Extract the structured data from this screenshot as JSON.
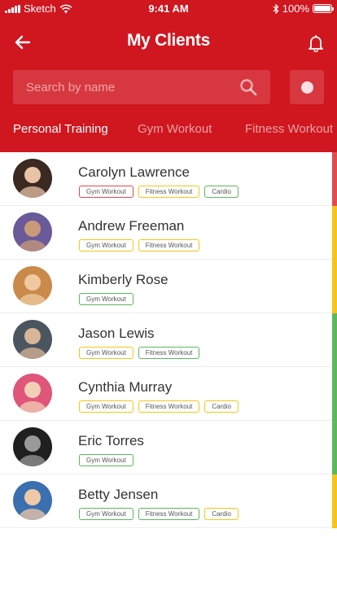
{
  "colors": {
    "primary": "#d0161f",
    "tag_red": "#e24a4f",
    "tag_yellow": "#f5c518",
    "tag_green": "#5cb85c"
  },
  "status_bar": {
    "carrier": "Sketch",
    "time": "9:41 AM",
    "battery": "100%",
    "battery_level": 1.0
  },
  "header": {
    "title": "My Clients",
    "back_icon": "arrow-left-icon",
    "notification_icon": "bell-icon"
  },
  "search": {
    "placeholder": "Search by name",
    "value": "",
    "icon": "search-icon"
  },
  "tabs": [
    {
      "label": "Personal Training",
      "active": true
    },
    {
      "label": "Gym Workout",
      "active": false
    },
    {
      "label": "Fitness Workout",
      "active": false
    }
  ],
  "clients": [
    {
      "name": "Carolyn Lawrence",
      "status_color": "#e24a4f",
      "avatar_colors": [
        "#3a2a22",
        "#e8c3a5"
      ],
      "tags": [
        {
          "label": "Gym Workout",
          "color": "#e24a4f"
        },
        {
          "label": "Fitness Workout",
          "color": "#f5c518"
        },
        {
          "label": "Cardio",
          "color": "#5cb85c"
        }
      ]
    },
    {
      "name": "Andrew Freeman",
      "status_color": "#f5c518",
      "avatar_colors": [
        "#6b5a9a",
        "#c89a78"
      ],
      "tags": [
        {
          "label": "Gym Workout",
          "color": "#f5c518"
        },
        {
          "label": "Fitness Workout",
          "color": "#f5c518"
        }
      ]
    },
    {
      "name": "Kimberly Rose",
      "status_color": "#f5c518",
      "avatar_colors": [
        "#c98a4a",
        "#f0c9a0"
      ],
      "tags": [
        {
          "label": "Gym Workout",
          "color": "#5cb85c"
        }
      ]
    },
    {
      "name": "Jason Lewis",
      "status_color": "#5cb85c",
      "avatar_colors": [
        "#4a5560",
        "#d9b597"
      ],
      "tags": [
        {
          "label": "Gym Workout",
          "color": "#f5c518"
        },
        {
          "label": "Fitness Workout",
          "color": "#5cb85c"
        }
      ]
    },
    {
      "name": "Cynthia Murray",
      "status_color": "#5cb85c",
      "avatar_colors": [
        "#e0557a",
        "#f2d0b8"
      ],
      "tags": [
        {
          "label": "Gym Workout",
          "color": "#f5c518"
        },
        {
          "label": "Fitness Workout",
          "color": "#f5c518"
        },
        {
          "label": "Cardio",
          "color": "#f5c518"
        }
      ]
    },
    {
      "name": "Eric Torres",
      "status_color": "#5cb85c",
      "avatar_colors": [
        "#1f1f1f",
        "#9a9a9a"
      ],
      "tags": [
        {
          "label": "Gym Workout",
          "color": "#5cb85c"
        }
      ]
    },
    {
      "name": "Betty Jensen",
      "status_color": "#f5c518",
      "avatar_colors": [
        "#3a6fb0",
        "#f0c8a8"
      ],
      "tags": [
        {
          "label": "Gym Workout",
          "color": "#5cb85c"
        },
        {
          "label": "Fitness Workout",
          "color": "#5cb85c"
        },
        {
          "label": "Cardio",
          "color": "#f5c518"
        }
      ]
    }
  ]
}
